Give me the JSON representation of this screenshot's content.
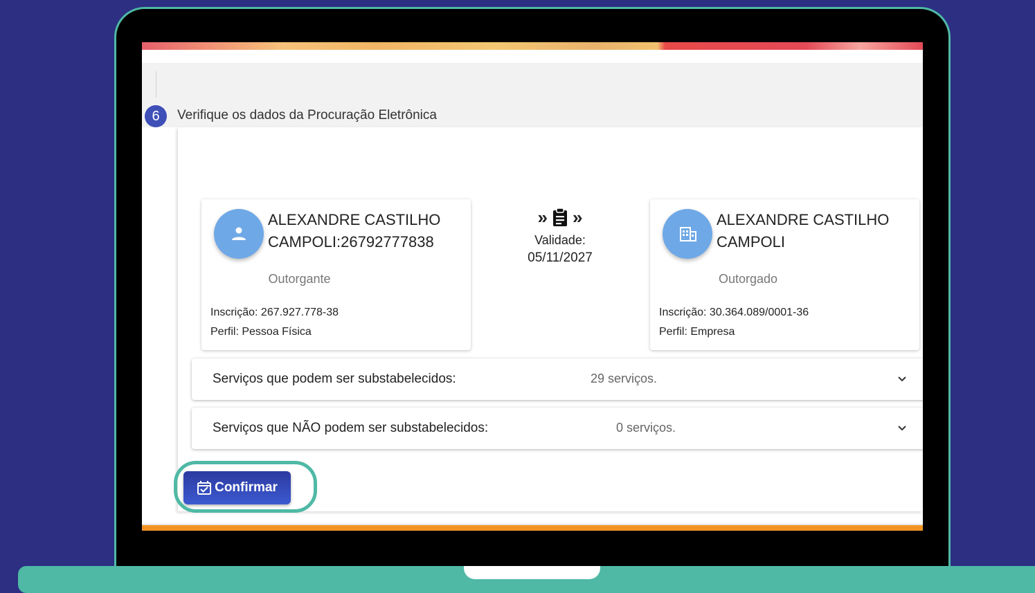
{
  "step": {
    "number": "6",
    "title": "Verifique os dados da Procuração Eletrônica"
  },
  "grantor": {
    "name": "ALEXANDRE CASTILHO CAMPOLI:26792777838",
    "role": "Outorgante",
    "registration": "Inscrição: 267.927.778-38",
    "profile": "Perfil: Pessoa Física",
    "icon": "person-icon"
  },
  "grantee": {
    "name": "ALEXANDRE CASTILHO CAMPOLI",
    "role": "Outorgado",
    "registration": "Inscrição: 30.364.089/0001-36",
    "profile": "Perfil: Empresa",
    "icon": "building-icon"
  },
  "validity": {
    "label": "Validade:",
    "date": "05/11/2027"
  },
  "services": [
    {
      "label": "Serviços que podem ser substabelecidos:",
      "count": "29 serviços."
    },
    {
      "label": "Serviços que NÃO podem ser substabelecidos:",
      "count": "0 serviços."
    }
  ],
  "confirm_label": "Confirmar",
  "colors": {
    "background": "#2c2f82",
    "laptop": "#4fb9a5",
    "button": "#2c3aa0",
    "avatar": "#6fa8e6",
    "step_badge": "#3f4fb8"
  }
}
